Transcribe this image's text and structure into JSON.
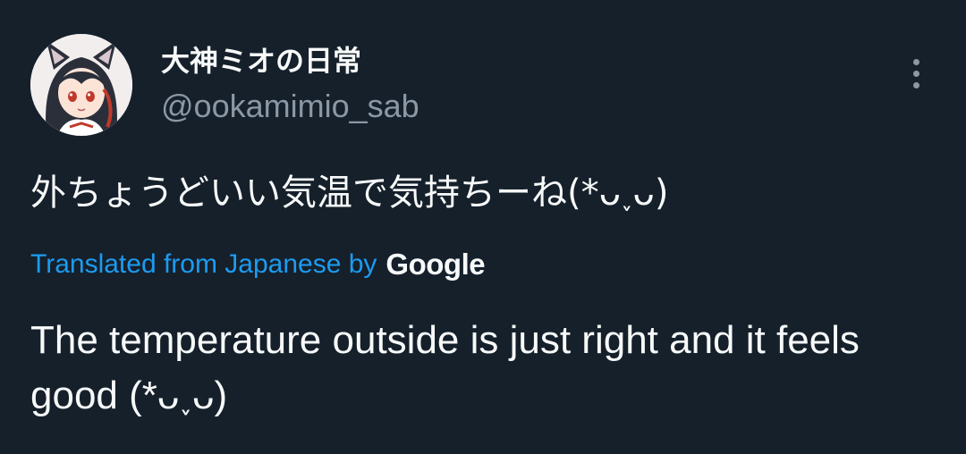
{
  "author": {
    "display_name": "大神ミオの日常",
    "handle": "@ookamimio_sab",
    "avatar_icon": "user-avatar-icon"
  },
  "tweet": {
    "original_text": "外ちょうどいい気温で気持ちーね(*ᴗ˯ᴗ)",
    "translation_label": "Translated from Japanese by",
    "translation_provider": "Google",
    "translated_text": "The temperature outside is just right and it feels good (*ᴗ˯ᴗ)"
  },
  "menu": {
    "more_icon": "more-vertical-icon"
  },
  "colors": {
    "background": "#15202b",
    "primary_text": "#f7f9f9",
    "secondary_text": "#8b98a5",
    "link": "#1d9bf0"
  }
}
